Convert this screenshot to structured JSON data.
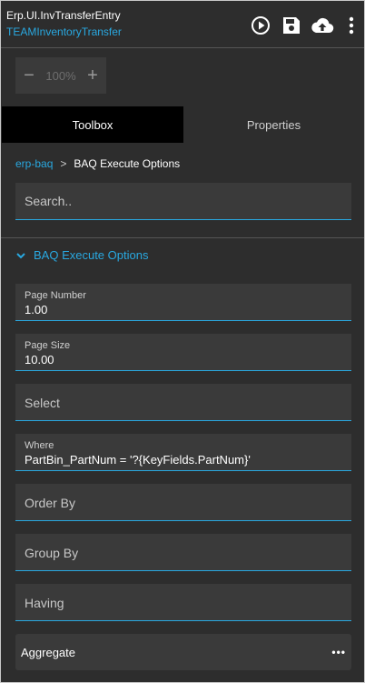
{
  "header": {
    "title": "Erp.UI.InvTransferEntry",
    "subtitle": "TEAMInventoryTransfer",
    "icons": [
      "play-icon",
      "save-icon",
      "cloud-upload-icon",
      "more-vertical-icon"
    ]
  },
  "zoom": {
    "decrease": "−",
    "value": "100%",
    "increase": "+"
  },
  "tabs": [
    {
      "label": "Toolbox",
      "active": true
    },
    {
      "label": "Properties",
      "active": false
    }
  ],
  "breadcrumb": {
    "root": "erp-baq",
    "separator": ">",
    "current": "BAQ Execute Options"
  },
  "search": {
    "placeholder": "Search.."
  },
  "section": {
    "title": "BAQ Execute Options",
    "icon": "chevron-down-icon"
  },
  "fields": {
    "page_number": {
      "label": "Page Number",
      "value": "1.00"
    },
    "page_size": {
      "label": "Page Size",
      "value": "10.00"
    },
    "select": {
      "label": "Select"
    },
    "where": {
      "label": "Where",
      "value": "PartBin_PartNum = '?{KeyFields.PartNum}'"
    },
    "order_by": {
      "label": "Order By"
    },
    "group_by": {
      "label": "Group By"
    },
    "having": {
      "label": "Having"
    }
  },
  "aggregate": {
    "label": "Aggregate",
    "more": "•••"
  },
  "colors": {
    "accent": "#29a8e0",
    "panel": "#2d2d2d",
    "field": "#3a3a3a",
    "active_tab": "#000000"
  }
}
